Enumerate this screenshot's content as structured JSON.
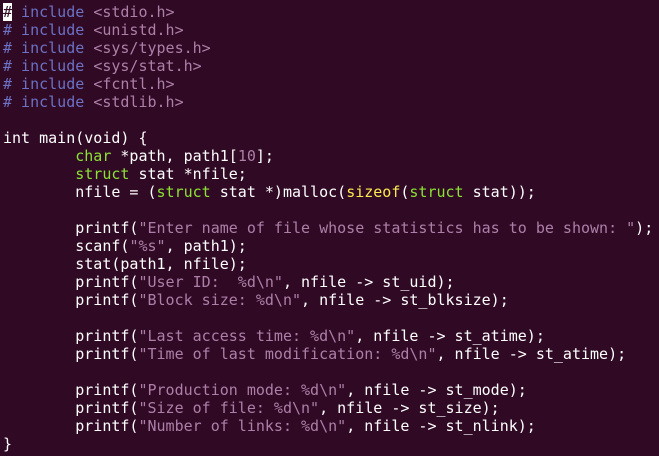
{
  "colors": {
    "background": "#300a24",
    "text": "#ffffff",
    "preprocessor": "#6c71c4",
    "header_string": "#ad7fa8",
    "type_keyword": "#8ae234",
    "string_literal": "#ad7fa8",
    "number_literal": "#ad7fa8",
    "operator_keyword": "#fce94f"
  },
  "editor": {
    "cursor_line": 1,
    "cursor_column": 1,
    "lines": [
      [
        {
          "t": "#",
          "c": "cursor"
        },
        {
          "t": " include ",
          "c": "pre"
        },
        {
          "t": "<stdio.h>",
          "c": "hdr"
        }
      ],
      [
        {
          "t": "# include ",
          "c": "pre"
        },
        {
          "t": "<unistd.h>",
          "c": "hdr"
        }
      ],
      [
        {
          "t": "# include ",
          "c": "pre"
        },
        {
          "t": "<sys/types.h>",
          "c": "hdr"
        }
      ],
      [
        {
          "t": "# include ",
          "c": "pre"
        },
        {
          "t": "<sys/stat.h>",
          "c": "hdr"
        }
      ],
      [
        {
          "t": "# include ",
          "c": "pre"
        },
        {
          "t": "<fcntl.h>",
          "c": "hdr"
        }
      ],
      [
        {
          "t": "# include ",
          "c": "pre"
        },
        {
          "t": "<stdlib.h>",
          "c": "hdr"
        }
      ],
      [],
      [
        {
          "t": "int main(void) {",
          "c": "plain"
        }
      ],
      [
        {
          "t": "        ",
          "c": "plain"
        },
        {
          "t": "char",
          "c": "type"
        },
        {
          "t": " *path, path1[",
          "c": "plain"
        },
        {
          "t": "10",
          "c": "num"
        },
        {
          "t": "];",
          "c": "plain"
        }
      ],
      [
        {
          "t": "        ",
          "c": "plain"
        },
        {
          "t": "struct",
          "c": "type"
        },
        {
          "t": " stat *nfile;",
          "c": "plain"
        }
      ],
      [
        {
          "t": "        nfile = (",
          "c": "plain"
        },
        {
          "t": "struct",
          "c": "type"
        },
        {
          "t": " stat *)malloc(",
          "c": "plain"
        },
        {
          "t": "sizeof",
          "c": "kw"
        },
        {
          "t": "(",
          "c": "plain"
        },
        {
          "t": "struct",
          "c": "type"
        },
        {
          "t": " stat));",
          "c": "plain"
        }
      ],
      [],
      [
        {
          "t": "        printf(",
          "c": "plain"
        },
        {
          "t": "\"Enter name of file whose statistics has to be shown: \"",
          "c": "str"
        },
        {
          "t": ");",
          "c": "plain"
        }
      ],
      [
        {
          "t": "        scanf(",
          "c": "plain"
        },
        {
          "t": "\"%s\"",
          "c": "str"
        },
        {
          "t": ", path1);",
          "c": "plain"
        }
      ],
      [
        {
          "t": "        stat(path1, nfile);",
          "c": "plain"
        }
      ],
      [
        {
          "t": "        printf(",
          "c": "plain"
        },
        {
          "t": "\"User ID:  %d\\n\"",
          "c": "str"
        },
        {
          "t": ", nfile -> st_uid);",
          "c": "plain"
        }
      ],
      [
        {
          "t": "        printf(",
          "c": "plain"
        },
        {
          "t": "\"Block size: %d\\n\"",
          "c": "str"
        },
        {
          "t": ", nfile -> st_blksize);",
          "c": "plain"
        }
      ],
      [],
      [
        {
          "t": "        printf(",
          "c": "plain"
        },
        {
          "t": "\"Last access time: %d\\n\"",
          "c": "str"
        },
        {
          "t": ", nfile -> st_atime);",
          "c": "plain"
        }
      ],
      [
        {
          "t": "        printf(",
          "c": "plain"
        },
        {
          "t": "\"Time of last modification: %d\\n\"",
          "c": "str"
        },
        {
          "t": ", nfile -> st_atime);",
          "c": "plain"
        }
      ],
      [],
      [
        {
          "t": "        printf(",
          "c": "plain"
        },
        {
          "t": "\"Production mode: %d\\n\"",
          "c": "str"
        },
        {
          "t": ", nfile -> st_mode);",
          "c": "plain"
        }
      ],
      [
        {
          "t": "        printf(",
          "c": "plain"
        },
        {
          "t": "\"Size of file: %d\\n\"",
          "c": "str"
        },
        {
          "t": ", nfile -> st_size);",
          "c": "plain"
        }
      ],
      [
        {
          "t": "        printf(",
          "c": "plain"
        },
        {
          "t": "\"Number of links: %d\\n\"",
          "c": "str"
        },
        {
          "t": ", nfile -> st_nlink);",
          "c": "plain"
        }
      ],
      [
        {
          "t": "}",
          "c": "plain"
        }
      ]
    ]
  }
}
